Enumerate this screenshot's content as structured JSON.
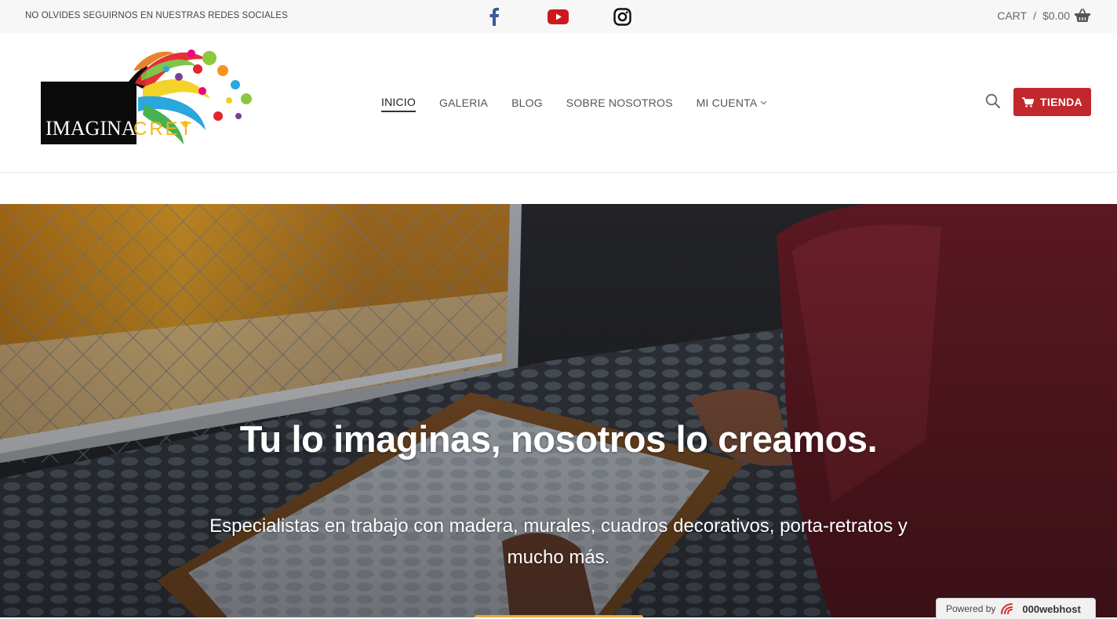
{
  "topbar": {
    "notice": "NO OLVIDES SEGUIRNOS EN NUESTRAS REDES SOCIALES",
    "social": [
      "facebook-icon",
      "youtube-icon",
      "instagram-icon"
    ],
    "cart_label": "CART",
    "cart_sep": "/",
    "cart_total": "$0.00"
  },
  "logo": {
    "text_main": "IMAGINA",
    "text_accent": "CRET"
  },
  "nav": {
    "items": [
      {
        "label": "INICIO",
        "active": true
      },
      {
        "label": "GALERIA"
      },
      {
        "label": "BLOG"
      },
      {
        "label": "SOBRE NOSOTROS"
      },
      {
        "label": "MI CUENTA",
        "has_dropdown": true
      }
    ]
  },
  "shop_button": {
    "label": "TIENDA"
  },
  "hero": {
    "title": "Tu lo imaginas, nosotros lo creamos.",
    "subtitle": "Especialistas en trabajo con madera, murales, cuadros decorativos, porta-retratos y mucho más."
  },
  "powered": {
    "prefix": "Powered by",
    "brand": "000webhost"
  },
  "colors": {
    "accent": "#c1272d",
    "facebook": "#3b5998",
    "youtube": "#cc181e"
  }
}
